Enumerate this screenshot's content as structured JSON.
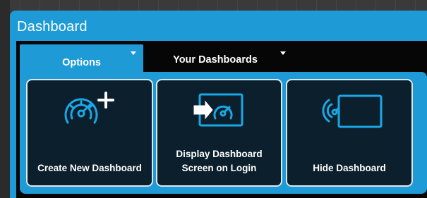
{
  "window": {
    "title": "Dashboard"
  },
  "tabs": [
    {
      "label": "Options",
      "active": true
    },
    {
      "label": "Your Dashboards",
      "active": false
    }
  ],
  "actions": [
    {
      "label": "Create New Dashboard",
      "icon": "gauge-plus-icon"
    },
    {
      "label": "Display Dashboard\nScreen on Login",
      "icon": "screen-gauge-arrow-icon"
    },
    {
      "label": "Hide Dashboard",
      "icon": "gauge-hide-screen-icon"
    }
  ],
  "colors": {
    "accent": "#1e9bd7",
    "card_bg": "#0b1f2c",
    "icon": "#1aa7e6",
    "content_bg": "#060606"
  }
}
